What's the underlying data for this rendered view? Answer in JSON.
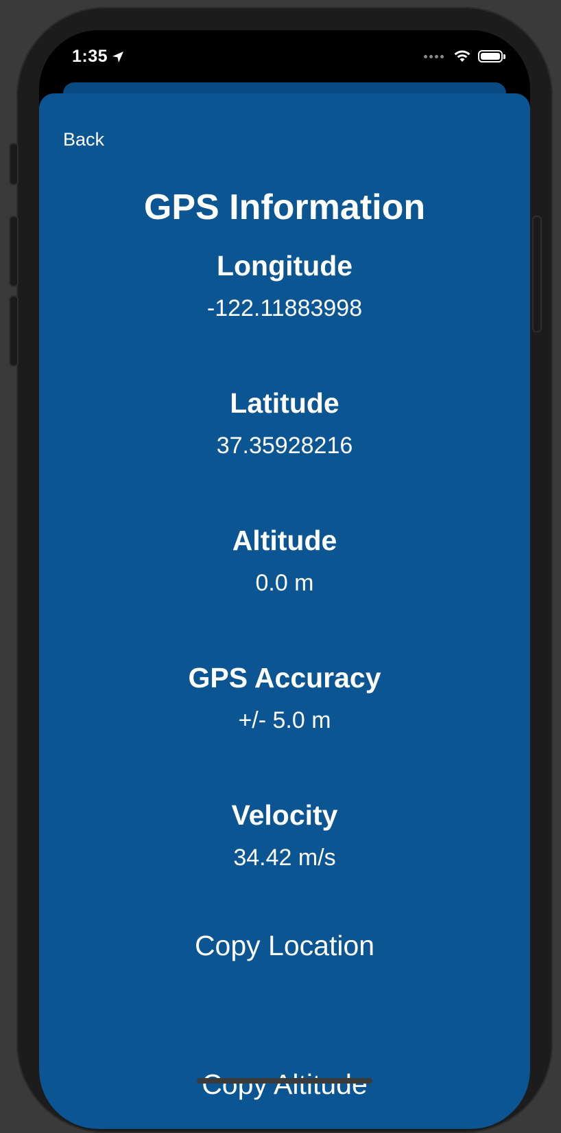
{
  "status_bar": {
    "time": "1:35",
    "icons": [
      "location-arrow-icon",
      "cellular-signal-icon",
      "wifi-icon",
      "battery-icon"
    ]
  },
  "nav": {
    "back_label": "Back"
  },
  "page": {
    "title": "GPS Information"
  },
  "info": {
    "longitude": {
      "label": "Longitude",
      "value": "-122.11883998"
    },
    "latitude": {
      "label": "Latitude",
      "value": "37.35928216"
    },
    "altitude": {
      "label": "Altitude",
      "value": "0.0 m"
    },
    "accuracy": {
      "label": "GPS Accuracy",
      "value": "+/- 5.0 m"
    },
    "velocity": {
      "label": "Velocity",
      "value": "34.42 m/s"
    }
  },
  "actions": {
    "copy_location": "Copy Location",
    "copy_altitude": "Copy Altitude"
  },
  "colors": {
    "sheet_background": "#0b5593",
    "text": "#ffffff",
    "device_frame": "#1c1c1c"
  }
}
